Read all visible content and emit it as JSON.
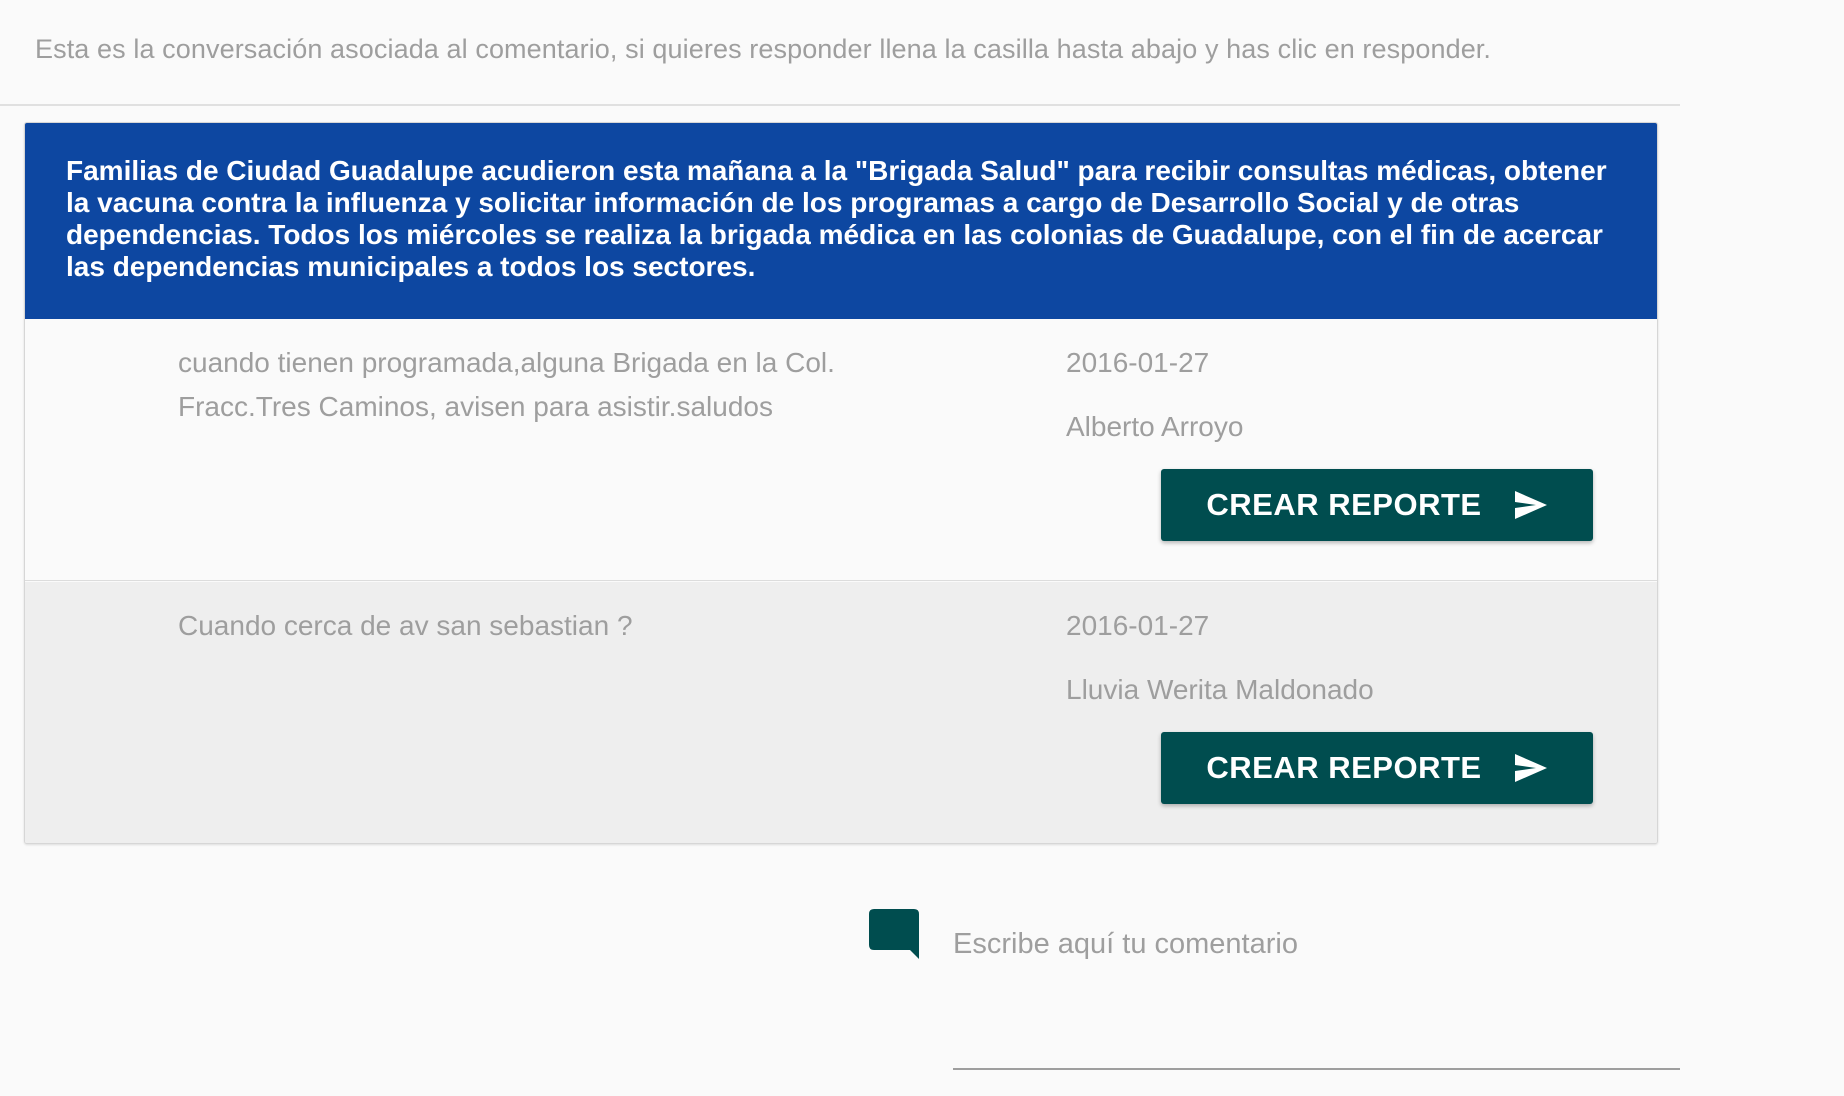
{
  "intro": {
    "text": "Esta es la conversación asociada al comentario, si quieres responder llena la casilla hasta abajo y has clic en responder."
  },
  "post": {
    "text": "Familias de Ciudad Guadalupe acudieron esta mañana a la \"Brigada Salud\" para recibir consultas médicas, obtener la vacuna contra la influenza y solicitar información de los programas a cargo de Desarrollo Social y de otras dependencias. Todos los miércoles se realiza la brigada médica en las colonias de Guadalupe, con el fin de acercar las dependencias municipales a todos los sectores."
  },
  "comments": [
    {
      "text": "cuando tienen programada,alguna Brigada en la Col. Fracc.Tres Caminos, avisen para asistir.saludos",
      "date": "2016-01-27",
      "author": "Alberto Arroyo",
      "button_label": "CREAR REPORTE"
    },
    {
      "text": "Cuando cerca de av san sebastian ?",
      "date": "2016-01-27",
      "author": "Lluvia Werita Maldonado",
      "button_label": "CREAR REPORTE"
    }
  ],
  "reply": {
    "placeholder": "Escribe aquí tu comentario",
    "value": "",
    "icon": "comment-icon"
  },
  "colors": {
    "header_bg": "#0d47a1",
    "button_bg": "#004d4f",
    "muted_text": "#9e9e9e"
  }
}
